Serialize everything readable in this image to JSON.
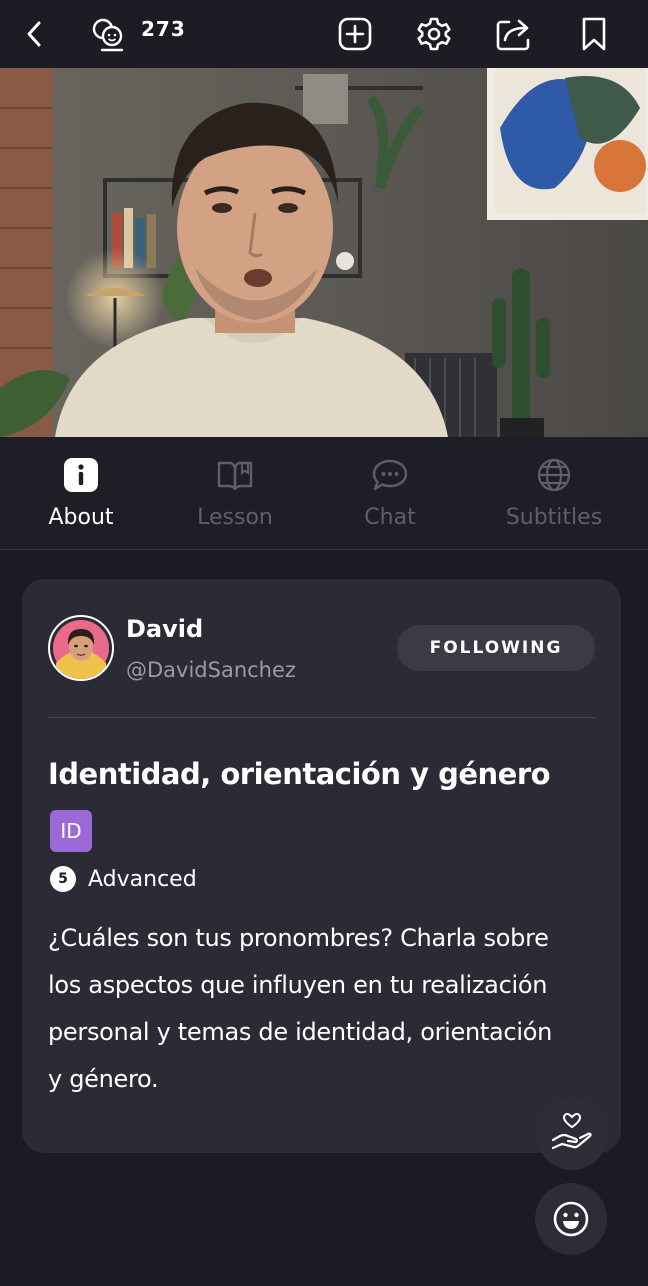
{
  "topbar": {
    "viewer_count": "273",
    "icons": [
      "chevron-left-icon",
      "community-icon",
      "plus-square-icon",
      "gear-icon",
      "share-icon",
      "bookmark-icon"
    ]
  },
  "tabs": [
    {
      "label": "About",
      "icon": "info-icon",
      "active": true
    },
    {
      "label": "Lesson",
      "icon": "book-icon",
      "active": false
    },
    {
      "label": "Chat",
      "icon": "chat-bubble-icon",
      "active": false
    },
    {
      "label": "Subtitles",
      "icon": "globe-icon",
      "active": false
    }
  ],
  "author": {
    "name": "David",
    "handle": "@DavidSanchez",
    "follow_label": "FOLLOWING"
  },
  "lesson": {
    "title": "Identidad, orientación y género",
    "badge": "ID",
    "level_number": "5",
    "level_label": "Advanced",
    "description": "¿Cuáles son tus pronombres? Charla sobre los aspectos que influyen en tu realización personal y temas de identidad, orientación y género."
  },
  "colors": {
    "background": "#1b1c23",
    "card": "#2a2b35",
    "badge": "#9b6ad6",
    "inactive_text": "#5d5f6a"
  }
}
